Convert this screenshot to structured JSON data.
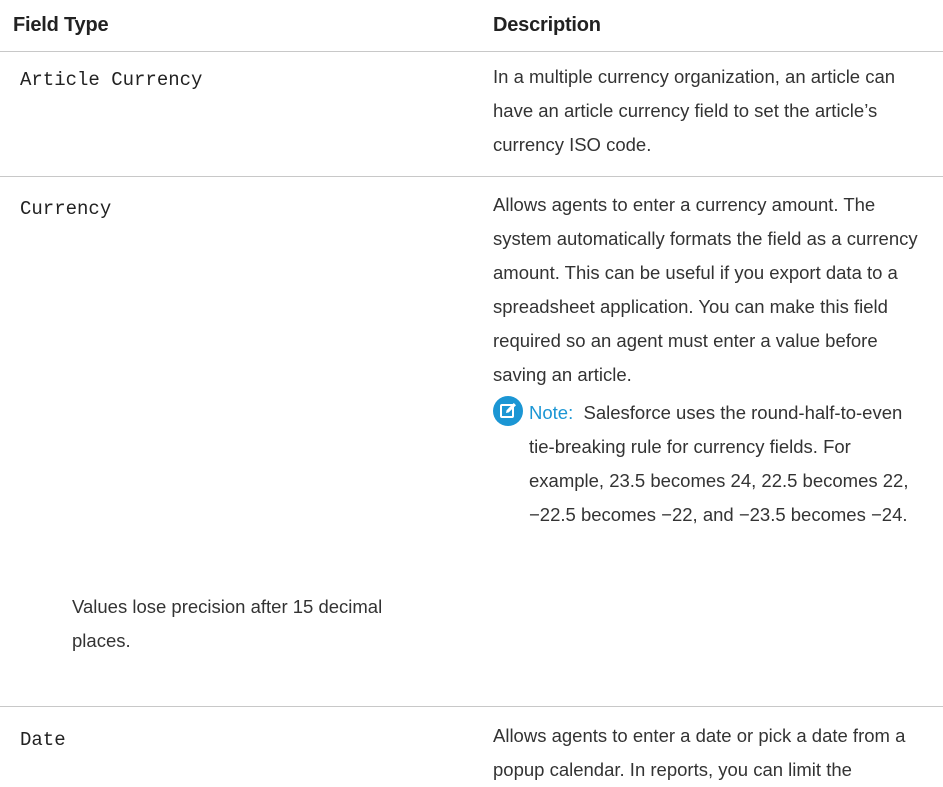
{
  "header": {
    "field_type": "Field Type",
    "description": "Description"
  },
  "rows": [
    {
      "field_type": "Article Currency",
      "description": "In a multiple currency organization, an article can have an article currency field to set the article’s currency ISO code."
    },
    {
      "field_type": "Currency",
      "description": "Allows agents to enter a currency amount. The system automatically formats the field as a currency amount. This can be useful if you export data to a spreadsheet application. You can make this field required so an agent must enter a value before saving an article.",
      "note": {
        "icon": "note-edit-icon",
        "label": "Note:",
        "text": "Salesforce uses the round-half-to-even tie-breaking rule for currency fields. For example, 23.5 becomes 24, 22.5 becomes 22, −22.5 becomes −22, and −23.5 becomes −24.",
        "extra": "Values lose precision after 15 decimal places."
      }
    },
    {
      "field_type": "Date",
      "description": "Allows agents to enter a date or pick a date from a popup calendar. In reports, you can limit the"
    }
  ],
  "colors": {
    "note_accent": "#1b96d4",
    "divider": "#c8c8c8"
  }
}
